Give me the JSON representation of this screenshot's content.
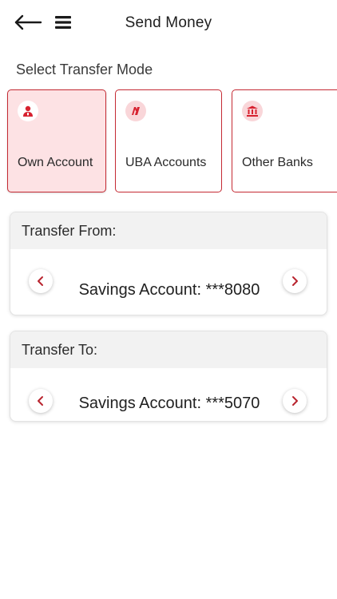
{
  "header": {
    "title": "Send Money",
    "back_icon": "arrow-left-icon",
    "menu_icon": "hamburger-menu-icon"
  },
  "transfer_mode": {
    "label": "Select Transfer Mode",
    "selected": "own",
    "options": [
      {
        "id": "own",
        "label": "Own Account",
        "icon": "person-icon"
      },
      {
        "id": "uba",
        "label": "UBA Accounts",
        "icon": "uba-logo-icon"
      },
      {
        "id": "other",
        "label": "Other Banks",
        "icon": "bank-icon"
      }
    ]
  },
  "transfer_from": {
    "label": "Transfer From:",
    "account": "Savings Account: ***8080"
  },
  "transfer_to": {
    "label": "Transfer To:",
    "account": "Savings Account: ***5070"
  },
  "colors": {
    "accent": "#c42a33",
    "selected_bg": "#fde2e4",
    "icon_bg": "#f9d6d9",
    "panel_header_bg": "#f2f2f2"
  }
}
